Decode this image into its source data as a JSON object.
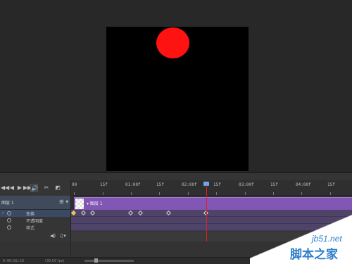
{
  "transport": {
    "first_frame": "◀◀",
    "prev_frame": "◀",
    "play": "▶",
    "next_frame": "▶▶",
    "audio": "🔊",
    "split": "✂",
    "transition": "◩"
  },
  "ruler": {
    "labels": [
      "00",
      "15f",
      "01:00f",
      "15f",
      "02:00f",
      "15f",
      "03:00f",
      "15f",
      "04:00f",
      "15f"
    ]
  },
  "layer": {
    "name": "图层 1",
    "clip_label": "▾ 图层 1",
    "menu": "⊞ ▾"
  },
  "properties": [
    {
      "label": "变换"
    },
    {
      "label": "不透明度"
    },
    {
      "label": "样式"
    }
  ],
  "audio_row": {
    "sound": "◀)",
    "note": "♫▾"
  },
  "status": {
    "timecode": "0:00:02:16",
    "fps": "(30.00 fps)"
  },
  "watermark": {
    "site": "jb51.net",
    "text": "脚本之家"
  },
  "colors": {
    "ball": "#ff1212",
    "clip": "#8156b4",
    "playhead": "#e02020"
  }
}
